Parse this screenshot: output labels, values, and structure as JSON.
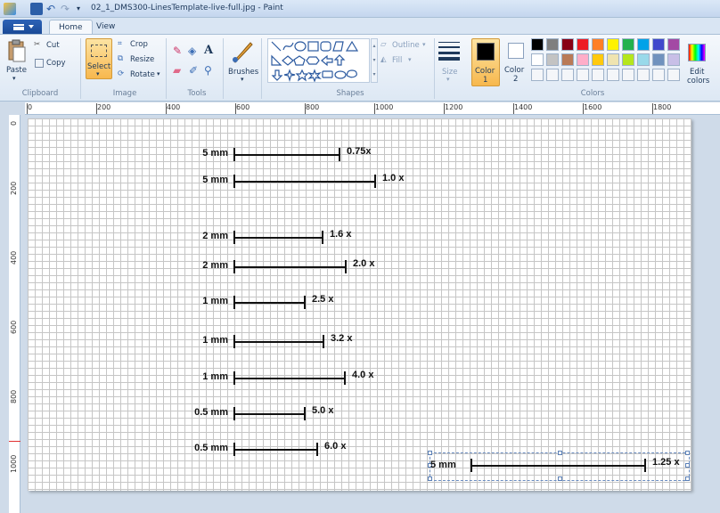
{
  "window": {
    "title": "02_1_DMS300-LinesTemplate-live-full.jpg - Paint"
  },
  "tabs": [
    {
      "label": "Home"
    },
    {
      "label": "View"
    }
  ],
  "ribbon": {
    "clipboard": {
      "paste": "Paste",
      "cut": "Cut",
      "copy": "Copy",
      "group": "Clipboard"
    },
    "image": {
      "select": "Select",
      "crop": "Crop",
      "resize": "Resize",
      "rotate": "Rotate",
      "group": "Image"
    },
    "tools": {
      "group": "Tools"
    },
    "brushes": {
      "label": "Brushes"
    },
    "shapes": {
      "outline": "Outline",
      "fill": "Fill",
      "group": "Shapes"
    },
    "size": {
      "label": "Size"
    },
    "color1": {
      "label": "Color",
      "num": "1"
    },
    "color2": {
      "label": "Color",
      "num": "2"
    },
    "colors": {
      "group": "Colors",
      "edit": "Edit",
      "edit2": "colors"
    }
  },
  "palette": {
    "row1": [
      "#000000",
      "#7f7f7f",
      "#880015",
      "#ed1c24",
      "#ff7f27",
      "#fff200",
      "#22b14c",
      "#00a2e8",
      "#3f48cc",
      "#a349a4"
    ],
    "row2": [
      "#ffffff",
      "#c3c3c3",
      "#b97a57",
      "#ffaec9",
      "#ffc90e",
      "#efe4b0",
      "#b5e61d",
      "#99d9ea",
      "#7092be",
      "#c8bfe7"
    ]
  },
  "ruler": {
    "h": [
      "0",
      "200",
      "400",
      "600",
      "800",
      "1000",
      "1200",
      "1400",
      "1600",
      "1800"
    ],
    "v": [
      "0",
      "200",
      "400",
      "600",
      "800",
      "1000"
    ]
  },
  "canvas_lines": [
    {
      "mm": "5 mm",
      "mult": "0.75x"
    },
    {
      "mm": "5 mm",
      "mult": "1.0  x"
    },
    {
      "mm": "2 mm",
      "mult": "1.6 x"
    },
    {
      "mm": "2 mm",
      "mult": "2.0 x"
    },
    {
      "mm": "1 mm",
      "mult": "2.5 x"
    },
    {
      "mm": "1 mm",
      "mult": "3.2 x"
    },
    {
      "mm": "1 mm",
      "mult": "4.0 x"
    },
    {
      "mm": "0.5 mm",
      "mult": "5.0 x"
    },
    {
      "mm": "0.5 mm",
      "mult": "6.0 x"
    }
  ],
  "selected_line": {
    "mm": "5 mm",
    "mult": "1.25 x"
  }
}
